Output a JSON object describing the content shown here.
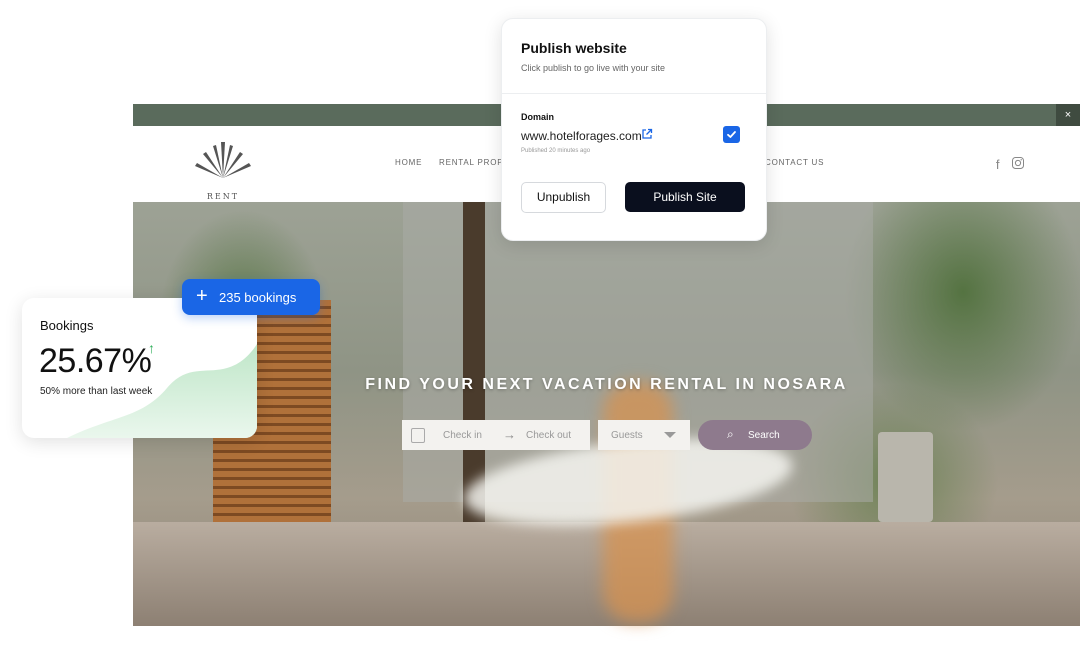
{
  "site": {
    "close_label": "×",
    "logo_text": "RENT NOSARA",
    "nav": [
      "HOME",
      "RENTAL PROPE",
      "CONTACT US"
    ],
    "socials": [
      "facebook-icon",
      "instagram-icon"
    ],
    "hero_title": "FIND YOUR NEXT VACATION RENTAL IN NOSARA",
    "booking": {
      "check_in": "Check in",
      "arrow": "→",
      "check_out": "Check out",
      "guests": "Guests",
      "search_label": "Search"
    }
  },
  "publish": {
    "title": "Publish website",
    "subtitle": "Click publish to go live with your site",
    "domain_label": "Domain",
    "domain_value": "www.hotelforages.com",
    "published_meta": "Published 20 minutes ago",
    "checked": true,
    "unpublish_label": "Unpublish",
    "publish_label": "Publish Site"
  },
  "bookings_card": {
    "label": "Bookings",
    "value": "25.67%",
    "trend": "↑",
    "note": "50% more than last week"
  },
  "chip": {
    "plus": "+",
    "text": "235 bookings"
  },
  "colors": {
    "accent": "#1a66e6",
    "topbar": "#5a6b5c",
    "search": "#8e7a8d",
    "publish_button": "#0a0f1e"
  }
}
